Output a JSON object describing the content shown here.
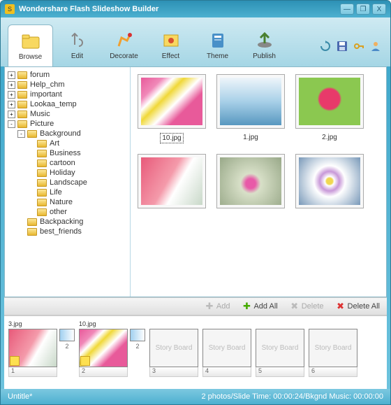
{
  "titlebar": {
    "text": "Wondershare  Flash Slideshow Builder"
  },
  "tabs": [
    {
      "label": "Browse",
      "active": true
    },
    {
      "label": "Edit"
    },
    {
      "label": "Decorate"
    },
    {
      "label": "Effect"
    },
    {
      "label": "Theme"
    },
    {
      "label": "Publish"
    }
  ],
  "tree": [
    {
      "indent": 0,
      "toggle": "+",
      "label": "forum"
    },
    {
      "indent": 0,
      "toggle": "+",
      "label": "Help_chm"
    },
    {
      "indent": 0,
      "toggle": "+",
      "label": "important"
    },
    {
      "indent": 0,
      "toggle": "+",
      "label": "Lookaa_temp"
    },
    {
      "indent": 0,
      "toggle": "+",
      "label": "Music"
    },
    {
      "indent": 0,
      "toggle": "-",
      "label": "Picture"
    },
    {
      "indent": 1,
      "toggle": "-",
      "label": "Background"
    },
    {
      "indent": 2,
      "toggle": "",
      "label": "Art"
    },
    {
      "indent": 2,
      "toggle": "",
      "label": "Business"
    },
    {
      "indent": 2,
      "toggle": "",
      "label": "cartoon"
    },
    {
      "indent": 2,
      "toggle": "",
      "label": "Holiday"
    },
    {
      "indent": 2,
      "toggle": "",
      "label": "Landscape"
    },
    {
      "indent": 2,
      "toggle": "",
      "label": "Life"
    },
    {
      "indent": 2,
      "toggle": "",
      "label": "Nature"
    },
    {
      "indent": 2,
      "toggle": "",
      "label": "other"
    },
    {
      "indent": 1,
      "toggle": "",
      "label": "Backpacking"
    },
    {
      "indent": 1,
      "toggle": "",
      "label": "best_friends"
    }
  ],
  "thumbs": [
    {
      "caption": "10.jpg",
      "selected": true,
      "bg": "linear-gradient(135deg,#e85a9a 0%,#f088b8 20%,#fff 30%,#f0d838 40%,#fff 55%,#e85a9a 70%)"
    },
    {
      "caption": "1.jpg",
      "bg": "linear-gradient(to top,#5898c0 0%,#a8d0e8 50%,#eef5fa 100%)"
    },
    {
      "caption": "2.jpg",
      "bg": "radial-gradient(circle at 50% 45%,#e83a6a 0%,#e83a6a 25%,#8bc850 30%,#8bc850 100%)"
    },
    {
      "caption": "",
      "bg": "linear-gradient(120deg,#e85a7a 0%,#f49aaa 45%,#fff 60%,#c8d8c8 100%)"
    },
    {
      "caption": "",
      "bg": "radial-gradient(circle at 50% 55%,#e85aa8 0%,#e85aa8 12%,#d8e0c8 25%,#98a888 100%)"
    },
    {
      "caption": "",
      "bg": "radial-gradient(circle at 50% 50%,#f0d850 0%,#f0d850 8%,#fff 12%,#c898d8 25%,#fff 40%,#7898b8 100%)"
    }
  ],
  "actions": {
    "add": "Add",
    "add_all": "Add All",
    "delete": "Delete",
    "delete_all": "Delete All"
  },
  "storyboard": {
    "empty_label": "Story Board",
    "slots": [
      {
        "caption": "3.jpg",
        "num": "1",
        "trans": "2",
        "bg": "linear-gradient(120deg,#e85a7a 0%,#f49aaa 45%,#fff 60%,#c8d8c8 100%)",
        "filled": true
      },
      {
        "caption": "10.jpg",
        "num": "2",
        "trans": "2",
        "bg": "linear-gradient(135deg,#e85a9a 0%,#f088b8 20%,#fff 30%,#f0d838 40%,#fff 55%,#e85a9a 70%)",
        "filled": true
      },
      {
        "caption": "",
        "num": "3",
        "trans": "",
        "filled": false
      },
      {
        "caption": "",
        "num": "4",
        "trans": "",
        "filled": false
      },
      {
        "caption": "",
        "num": "5",
        "trans": "",
        "filled": false
      },
      {
        "caption": "",
        "num": "6",
        "trans": "",
        "filled": false
      }
    ]
  },
  "status": {
    "left": "Untitle*",
    "right": "2 photos/Slide Time: 00:00:24/Bkgnd Music: 00:00:00"
  }
}
